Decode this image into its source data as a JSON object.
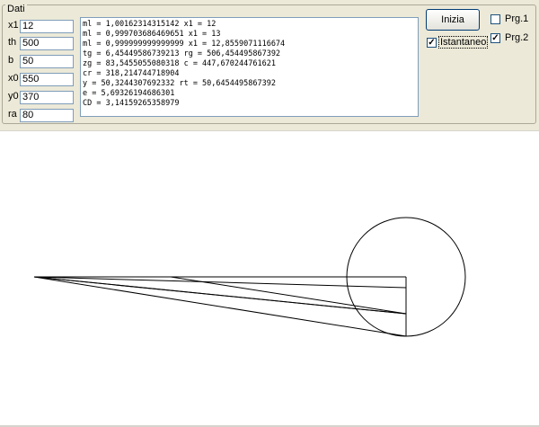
{
  "group_title": "Dati",
  "params": [
    {
      "label": "x1",
      "value": "12"
    },
    {
      "label": "th",
      "value": "500"
    },
    {
      "label": "b",
      "value": "50"
    },
    {
      "label": "x0",
      "value": "550"
    },
    {
      "label": "y0",
      "value": "370"
    },
    {
      "label": "ra",
      "value": "80"
    }
  ],
  "output_lines": [
    "ml = 1,00162314315142 x1 = 12",
    "ml = 0,999703686469651 x1 = 13",
    "ml = 0,999999999999999 x1 = 12,8559071116674",
    "tg = 6,45449586739213 rg = 506,454495867392",
    "zg = 83,5455055080318 c = 447,670244761621",
    "cr = 318,214744718904",
    "y = 50,3244307692332 rt = 50,6454495867392",
    "e = 5,69326194686301",
    "CD = 3,14159265358979"
  ],
  "start_button": "Inizia",
  "checkboxes": {
    "istantaneo": {
      "label": "Istantaneo",
      "checked": true
    },
    "prg1": {
      "label": "Prg.1",
      "checked": false
    },
    "prg2": {
      "label": "Prg.2",
      "checked": true
    }
  },
  "checkmark_glyph": "✓"
}
